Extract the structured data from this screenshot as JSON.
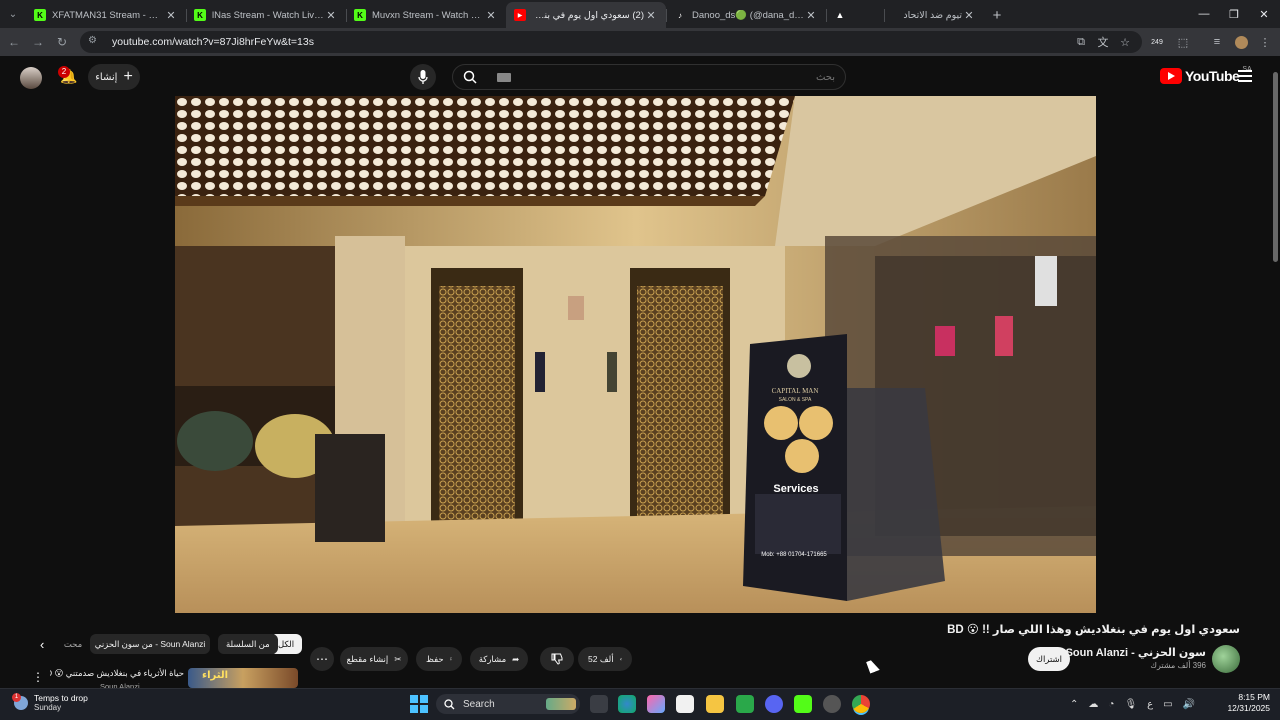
{
  "tabs": [
    {
      "title": "XFATMAN31 Stream - Watch Li...",
      "favicon_color": "#53fc18",
      "favicon_letter": "K"
    },
    {
      "title": "lNas Stream - Watch Live on Ki...",
      "favicon_color": "#53fc18",
      "favicon_letter": "K"
    },
    {
      "title": "Muvxn Stream - Watch Live on...",
      "favicon_color": "#53fc18",
      "favicon_letter": "K"
    },
    {
      "title": "(2) سعودي اول يوم في بنغلاديش",
      "favicon_color": "#ff0000",
      "favicon_letter": "▶",
      "active": true
    },
    {
      "title": "Danoo_ds🟢 (@dana_ds5) | Tik...",
      "favicon_color": "#ffffff",
      "favicon_letter": "♪"
    },
    {
      "title": "",
      "favicon_color": "#ffffff",
      "favicon_letter": "🔥"
    },
    {
      "title": "تيوم ضد الاتحاد",
      "favicon_color": "",
      "favicon_letter": ""
    }
  ],
  "toolbar": {
    "url": "youtube.com/watch?v=87Ji8hrFeYw&t=13s",
    "extension_badge": "249"
  },
  "masthead": {
    "notifications_count": "2",
    "create_label": "إنشاء",
    "search_placeholder": "بحث",
    "logo_text": "YouTube",
    "country_code": "SA"
  },
  "video": {
    "title": "سعودي اول يوم في بنغلاديش وهذا اللي صار !! 😮 BD",
    "sign_title": "Services",
    "sign_brand": "CAPITAL MAN",
    "sign_sub": "SALON & SPA",
    "sign_footer": "Mob: +88 01704-171665"
  },
  "channel": {
    "name": "سون الحزني - Soun Alanzi",
    "subscribers": "396 ألف مشترك",
    "subscribe_label": "اشتراك"
  },
  "actions": {
    "likes": "52 ألف",
    "share_label": "مشاركة",
    "save_label": "حفظ",
    "clip_label": "إنشاء مقطع"
  },
  "chips": {
    "all": "الكل",
    "from_series": "من السلسلة",
    "from_channel": "من سون الحزني - Soun Alanzi",
    "related": "محت"
  },
  "recommended": {
    "title": "حياة الأثرياء في بنغلاديش صدمتني 😮 BD",
    "channel": "Soun Alanzi",
    "thumb_text": "الثراء"
  },
  "taskbar": {
    "weather_line1": "Temps to drop",
    "weather_line2": "Sunday",
    "weather_badge": "1",
    "search_label": "Search",
    "lang": "ع",
    "time": "8:15 PM",
    "date": "12/31/2025"
  }
}
